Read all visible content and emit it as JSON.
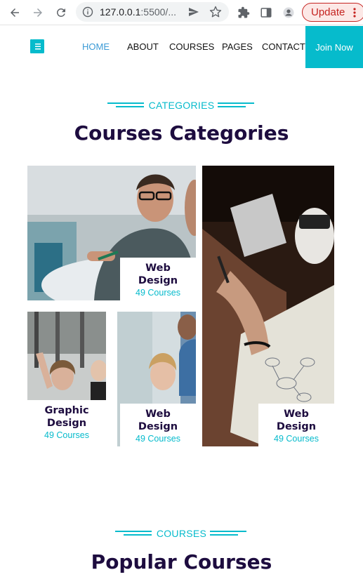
{
  "browser": {
    "url_main": "127.0.0.1",
    "url_rest": ":5500/...",
    "update_label": "Update"
  },
  "header": {
    "nav": [
      "HOME",
      "ABOUT",
      "COURSES",
      "PAGES",
      "CONTACT"
    ],
    "active_nav": "HOME",
    "join_label": "Join Now"
  },
  "categories_section": {
    "label": "CATEGORIES",
    "title": "Courses Categories",
    "cards": [
      {
        "name": "Web Design",
        "count": "49 Courses"
      },
      {
        "name": "Graphic Design",
        "count": "49 Courses"
      },
      {
        "name": "Web Design",
        "count": "49 Courses"
      },
      {
        "name": "Web Design",
        "count": "49 Courses"
      }
    ]
  },
  "courses_section": {
    "label": "COURSES",
    "title": "Popular Courses"
  },
  "colors": {
    "accent": "#06bbcc",
    "nav_active": "#3c9bd6",
    "heading": "#1d0c3f",
    "update_red": "#c5221f"
  },
  "icons": [
    "back-arrow-icon",
    "forward-arrow-icon",
    "reload-icon",
    "info-icon",
    "share-icon",
    "star-icon",
    "extensions-icon",
    "sidebar-icon",
    "profile-icon",
    "menu-dots-icon",
    "book-logo-icon"
  ]
}
